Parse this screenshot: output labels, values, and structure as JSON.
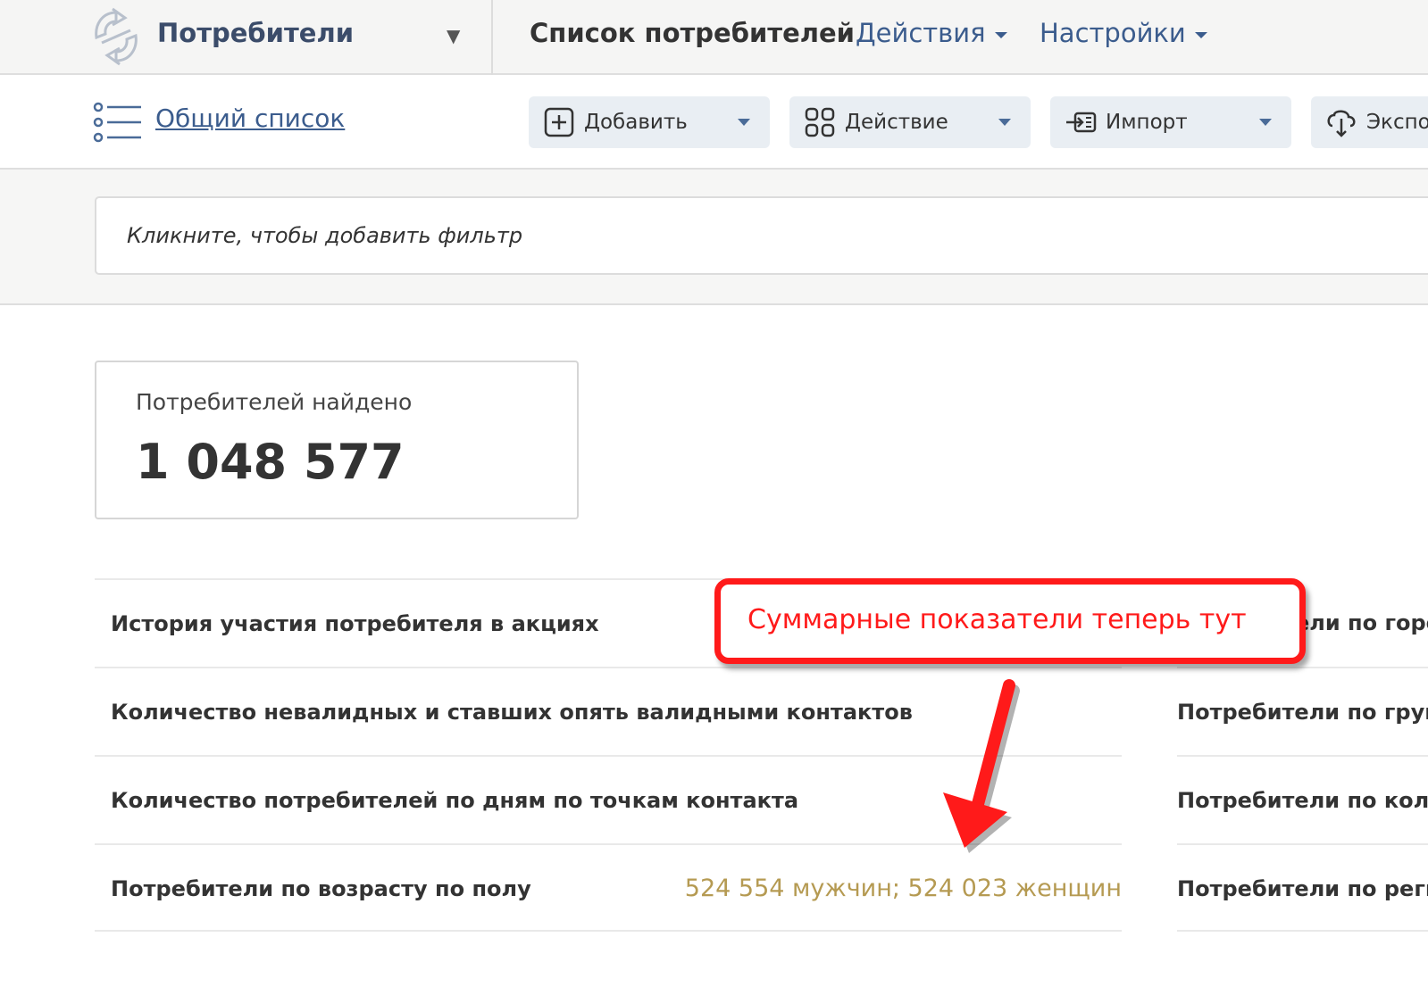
{
  "header": {
    "app_title": "Потребители",
    "current_page": "Список потребителей",
    "menus": [
      {
        "label": "Действия"
      },
      {
        "label": "Настройки"
      }
    ]
  },
  "toolbar": {
    "list_link": "Общий список",
    "buttons": [
      {
        "label": "Добавить",
        "icon": "plus-square-icon"
      },
      {
        "label": "Действие",
        "icon": "grid-icon"
      },
      {
        "label": "Импорт",
        "icon": "import-icon"
      },
      {
        "label": "Экспо",
        "icon": "export-icon"
      }
    ]
  },
  "filter": {
    "placeholder": "Кликните, чтобы добавить фильтр"
  },
  "stats": {
    "label": "Потребителей найдено",
    "value": "1 048 577"
  },
  "reports": {
    "left": [
      {
        "title": "История участия потребителя в акциях",
        "metric": ""
      },
      {
        "title": "Количество невалидных и ставших опять валидными контактов",
        "metric": ""
      },
      {
        "title": "Количество потребителей по дням по точкам контакта",
        "metric": ""
      },
      {
        "title": "Потребители по возрасту по полу",
        "metric": "524 554 мужчин; 524 023 женщин"
      }
    ],
    "right": [
      {
        "title": "ели по горо"
      },
      {
        "title": "Потребители по груп"
      },
      {
        "title": "Потребители по колі"
      },
      {
        "title": "Потребители по реги"
      }
    ]
  },
  "annotation": {
    "text": "Суммарные показатели теперь тут"
  },
  "colors": {
    "accent": "#3b5c8d",
    "metric": "#b59a52",
    "annotation": "#ff1a1a"
  }
}
